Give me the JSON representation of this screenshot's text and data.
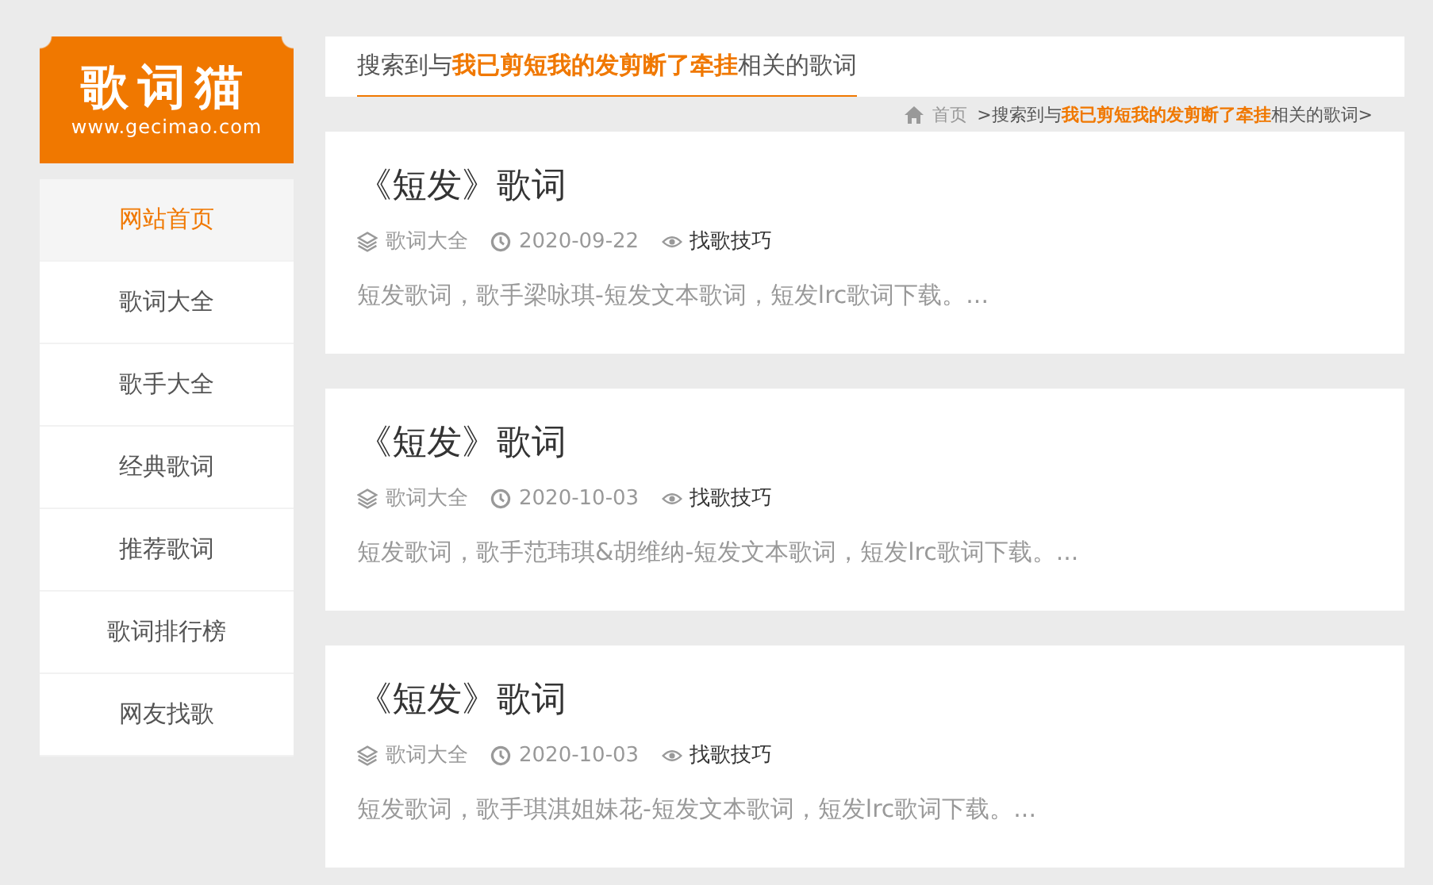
{
  "logo": {
    "name": "歌词猫",
    "url": "www.gecimao.com"
  },
  "nav": [
    {
      "label": "网站首页",
      "selected": true
    },
    {
      "label": "歌词大全",
      "selected": false
    },
    {
      "label": "歌手大全",
      "selected": false
    },
    {
      "label": "经典歌词",
      "selected": false
    },
    {
      "label": "推荐歌词",
      "selected": false
    },
    {
      "label": "歌词排行榜",
      "selected": false
    },
    {
      "label": "网友找歌",
      "selected": false
    }
  ],
  "heading": "搜索到与**我已剪短我的发剪断了牵挂**相关的歌词",
  "breadcrumb": {
    "home": "首页",
    "current": ">搜索到与**我已剪短我的发剪断了牵挂**相关的歌词>"
  },
  "results": [
    {
      "title": "《短发》歌词",
      "category": "歌词大全",
      "date": "2020-09-22",
      "tag": "找歌技巧",
      "summary": "短发歌词，歌手梁咏琪-短发文本歌词，短发lrc歌词下载。..."
    },
    {
      "title": "《短发》歌词",
      "category": "歌词大全",
      "date": "2020-10-03",
      "tag": "找歌技巧",
      "summary": "短发歌词，歌手范玮琪&胡维纳-短发文本歌词，短发lrc歌词下载。..."
    },
    {
      "title": "《短发》歌词",
      "category": "歌词大全",
      "date": "2020-10-03",
      "tag": "找歌技巧",
      "summary": "短发歌词，歌手琪淇姐妹花-短发文本歌词，短发lrc歌词下载。..."
    }
  ]
}
